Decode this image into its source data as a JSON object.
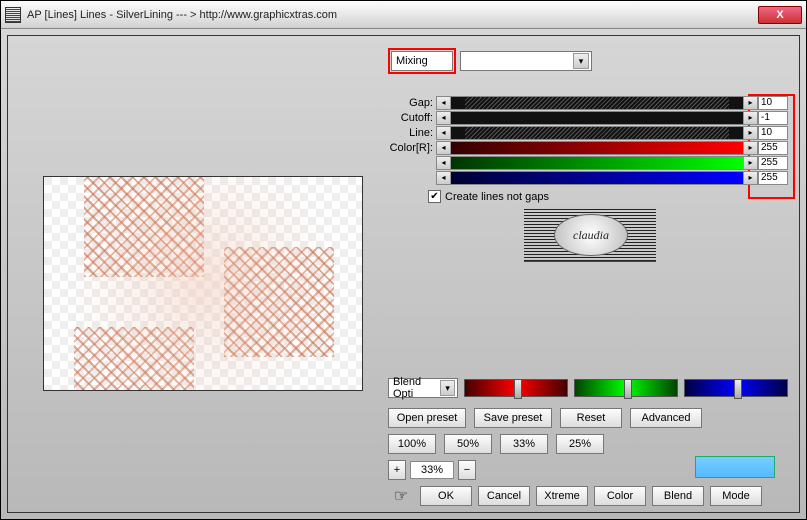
{
  "title": "AP [Lines]  Lines - SilverLining   --- > http://www.graphicxtras.com",
  "closeX": "X",
  "topbox": {
    "label": "Mixing"
  },
  "params": {
    "gap": {
      "label": "Gap:",
      "value": "10"
    },
    "cutoff": {
      "label": "Cutoff:",
      "value": "-1"
    },
    "line": {
      "label": "Line:",
      "value": "10"
    },
    "colr": {
      "label": "Color[R]:",
      "value": "255"
    },
    "colg": {
      "label": "",
      "value": "255"
    },
    "colb": {
      "label": "",
      "value": "255"
    }
  },
  "checkbox": {
    "checked": true,
    "label": "Create lines not gaps"
  },
  "logo_text": "claudia",
  "blend": {
    "dropdown": "Blend Opti"
  },
  "preset_row": {
    "open": "Open preset",
    "save": "Save preset",
    "reset": "Reset",
    "advanced": "Advanced"
  },
  "pct_row": {
    "p100": "100%",
    "p50": "50%",
    "p33": "33%",
    "p25": "25%"
  },
  "zoom": {
    "plus": "+",
    "minus": "−",
    "value": "33%"
  },
  "bottom": {
    "ok": "OK",
    "cancel": "Cancel",
    "xtreme": "Xtreme",
    "color": "Color",
    "blend": "Blend",
    "mode": "Mode"
  },
  "colors": {
    "accent_red": "#ff0000"
  }
}
